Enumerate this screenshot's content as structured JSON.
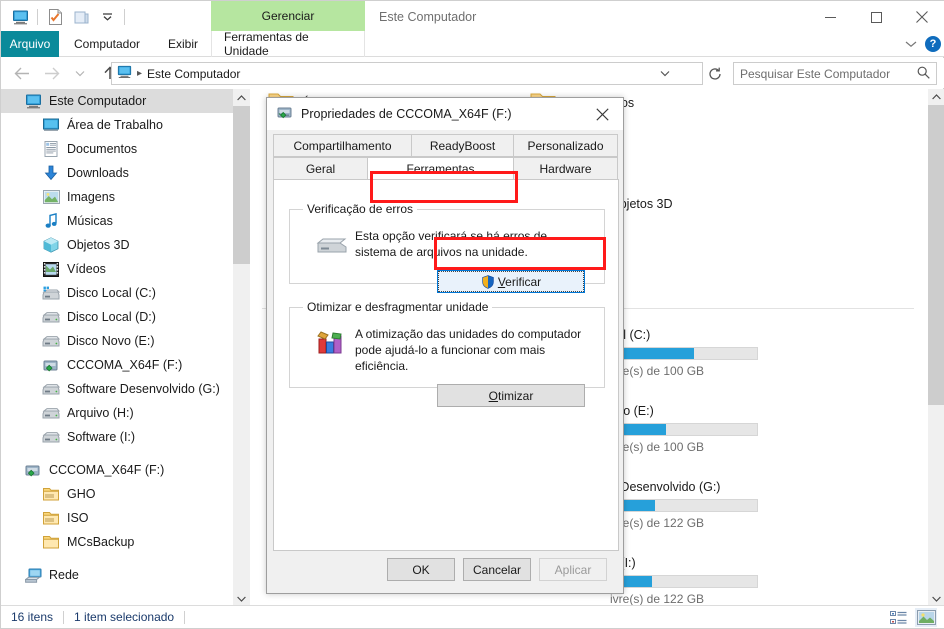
{
  "window": {
    "title": "Este Computador",
    "contextual_tab_group": "Gerenciar",
    "minimize": "minimize-icon",
    "maximize": "maximize-icon",
    "close": "close-icon"
  },
  "quick_access_toolbar": [
    {
      "name": "this-pc-icon",
      "label": "Este Computador"
    },
    {
      "name": "properties-icon",
      "label": "Propriedades"
    },
    {
      "name": "new-folder-icon",
      "label": "Nova pasta"
    },
    {
      "name": "customize-dropdown-icon",
      "label": "Personalizar Barra de Ferramentas de Acesso Rapido"
    }
  ],
  "ribbon": {
    "tabs": [
      {
        "label": "Arquivo",
        "active": true
      },
      {
        "label": "Computador",
        "active": false
      },
      {
        "label": "Exibir",
        "active": false
      },
      {
        "label": "Ferramentas de Unidade",
        "active": false
      }
    ],
    "collapse_icon": "chevron-down-icon",
    "help_label": "?"
  },
  "address_bar": {
    "back": "back-arrow-icon",
    "forward": "forward-arrow-icon",
    "recent": "chevron-down-icon",
    "up": "up-arrow-icon",
    "crumb_icon": "this-pc-icon",
    "path": "Este Computador",
    "dropdown": "chevron-down-icon",
    "refresh": "refresh-icon"
  },
  "search": {
    "placeholder": "Pesquisar Este Computador",
    "icon": "search-icon"
  },
  "navigation_pane": {
    "items": [
      {
        "label": "Este Computador",
        "icon": "monitor-icon",
        "level": 0,
        "selected": true
      },
      {
        "label": "Área de Trabalho",
        "icon": "desktop-icon",
        "level": 1,
        "selected": false
      },
      {
        "label": "Documentos",
        "icon": "documents-icon",
        "level": 1,
        "selected": false
      },
      {
        "label": "Downloads",
        "icon": "downloads-icon",
        "level": 1,
        "selected": false
      },
      {
        "label": "Imagens",
        "icon": "pictures-icon",
        "level": 1,
        "selected": false
      },
      {
        "label": "Músicas",
        "icon": "music-icon",
        "level": 1,
        "selected": false
      },
      {
        "label": "Objetos 3D",
        "icon": "3d-objects-icon",
        "level": 1,
        "selected": false
      },
      {
        "label": "Vídeos",
        "icon": "videos-icon",
        "level": 1,
        "selected": false
      },
      {
        "label": "Disco Local (C:)",
        "icon": "system-drive-icon",
        "level": 1,
        "selected": false
      },
      {
        "label": "Disco Local (D:)",
        "icon": "drive-icon",
        "level": 1,
        "selected": false
      },
      {
        "label": "Disco Novo (E:)",
        "icon": "drive-icon",
        "level": 1,
        "selected": false
      },
      {
        "label": "CCCOMA_X64F (F:)",
        "icon": "optical-drive-icon",
        "level": 1,
        "selected": false
      },
      {
        "label": "Software Desenvolvido (G:)",
        "icon": "drive-icon",
        "level": 1,
        "selected": false
      },
      {
        "label": "Arquivo (H:)",
        "icon": "drive-icon",
        "level": 1,
        "selected": false
      },
      {
        "label": "Software (I:)",
        "icon": "drive-icon",
        "level": 1,
        "selected": false
      },
      {
        "label": "CCCOMA_X64F (F:)",
        "icon": "optical-drive-icon",
        "level": 0,
        "selected": false,
        "spacer_before": true
      },
      {
        "label": "GHO",
        "icon": "folder-gho-icon",
        "level": 1,
        "selected": false
      },
      {
        "label": "ISO",
        "icon": "folder-iso-icon",
        "level": 1,
        "selected": false
      },
      {
        "label": "MCsBackup",
        "icon": "folder-icon",
        "level": 1,
        "selected": false
      },
      {
        "label": "Rede",
        "icon": "network-icon",
        "level": 0,
        "selected": false,
        "spacer_before": true
      }
    ],
    "scrollbar": {
      "up": "scroll-up-icon",
      "down": "scroll-down-icon"
    }
  },
  "content_pane": {
    "folders_partial": [
      {
        "label": "Área de Trabalho",
        "icon": "folder-icon"
      },
      {
        "label": "Documentos",
        "icon": "folder-icon"
      },
      {
        "label": "Objetos 3D",
        "icon": "folder-icon"
      }
    ],
    "drives": [
      {
        "name": "Disco Local (C:)",
        "name_visible": "cal (C:)",
        "used_percent": 57,
        "sub": "livre(s) de 100 GB",
        "sub_visible": "ivre(s) de 100 GB"
      },
      {
        "name": "Disco Novo (E:)",
        "name_visible": "ovo (E:)",
        "used_percent": 38,
        "sub": "livre(s) de 100 GB",
        "sub_visible": "ivre(s) de 100 GB"
      },
      {
        "name": "Software Desenvolvido (G:)",
        "name_visible": "e Desenvolvido (G:)",
        "used_percent": 30,
        "sub": "livre(s) de 122 GB",
        "sub_visible": "ivre(s) de 122 GB"
      },
      {
        "name": "Software (I:)",
        "name_visible": "e (I:)",
        "used_percent": 28,
        "sub": "livre(s) de 122 GB",
        "sub_visible": "ivre(s) de 122 GB"
      }
    ],
    "scrollbar": {
      "up": "scroll-up-icon",
      "down": "scroll-down-icon"
    }
  },
  "status_bar": {
    "item_count": "16 itens",
    "selection": "1 item selecionado",
    "views": [
      {
        "name": "details-view-icon",
        "active": false
      },
      {
        "name": "large-icons-view-icon",
        "active": true
      }
    ]
  },
  "dialog": {
    "title": "Propriedades de CCCOMA_X64F (F:)",
    "title_icon": "optical-drive-icon",
    "close_icon": "close-icon",
    "tabs_row1": [
      {
        "label": "Compartilhamento",
        "active": false
      },
      {
        "label": "ReadyBoost",
        "active": false
      },
      {
        "label": "Personalizado",
        "active": false
      }
    ],
    "tabs_row2": [
      {
        "label": "Geral",
        "active": false
      },
      {
        "label": "Ferramentas",
        "active": true
      },
      {
        "label": "Hardware",
        "active": false
      }
    ],
    "error_check": {
      "legend": "Verificação de erros",
      "icon": "drive-check-icon",
      "description": "Esta opção verificará se há erros de sistema de arquivos na unidade.",
      "button_label": "Verificar",
      "button_mnemonic": "V",
      "button_shield": "uac-shield-icon",
      "button_focused": true
    },
    "optimize": {
      "legend": "Otimizar e desfragmentar unidade",
      "icon": "defrag-icon",
      "description": "A otimização das unidades do computador pode ajudá-lo a funcionar com mais eficiência.",
      "button_label": "Otimizar",
      "button_mnemonic": "O"
    },
    "footer_buttons": [
      {
        "label": "OK",
        "enabled": true
      },
      {
        "label": "Cancelar",
        "enabled": true
      },
      {
        "label": "Aplicar",
        "enabled": false
      }
    ]
  },
  "annotations": {
    "color": "#ff1a1a",
    "boxes": [
      {
        "name": "ferramentas-tab-highlight"
      },
      {
        "name": "verificar-button-highlight"
      }
    ]
  },
  "colors": {
    "file_tab": "#0a8a9a",
    "contextual_tab": "#b6e6a0",
    "progress": "#26a0da",
    "focus_border": "#0078d7",
    "annotation": "#ff1a1a"
  }
}
